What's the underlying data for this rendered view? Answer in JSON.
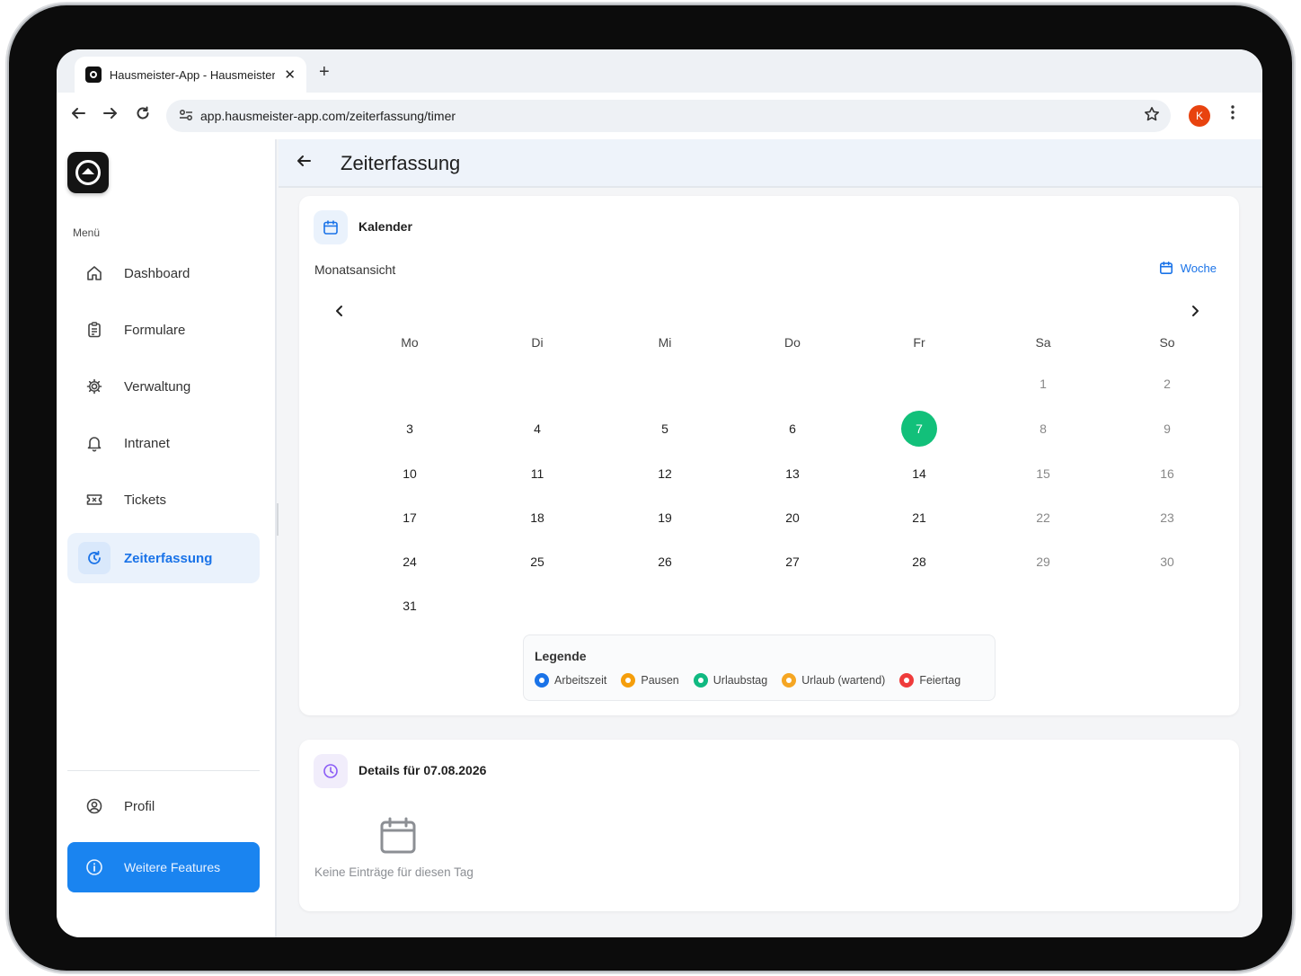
{
  "browser": {
    "tab_title": "Hausmeister-App - Hausmeister",
    "url": "app.hausmeister-app.com/zeiterfassung/timer",
    "profile_initial": "K",
    "new_tab": "+",
    "close": "✕"
  },
  "sidebar": {
    "menu_label": "Menü",
    "items": [
      {
        "label": "Dashboard",
        "icon": "home-icon"
      },
      {
        "label": "Formulare",
        "icon": "clipboard-icon"
      },
      {
        "label": "Verwaltung",
        "icon": "gear-icon"
      },
      {
        "label": "Intranet",
        "icon": "bell-icon"
      },
      {
        "label": "Tickets",
        "icon": "ticket-icon"
      },
      {
        "label": "Zeiterfassung",
        "icon": "timer-icon",
        "active": true
      }
    ],
    "profile_label": "Profil",
    "features_label": "Weitere Features"
  },
  "header": {
    "title": "Zeiterfassung"
  },
  "calendar": {
    "title": "Kalender",
    "view_label": "Monatsansicht",
    "week_button": "Woche",
    "weekdays": [
      "Mo",
      "Di",
      "Mi",
      "Do",
      "Fr",
      "Sa",
      "So"
    ],
    "first_weekday_index": 5,
    "days_in_month": 31,
    "selected_day": 7,
    "legend_title": "Legende",
    "legend": [
      {
        "label": "Arbeitszeit",
        "color": "#1a73e8"
      },
      {
        "label": "Pausen",
        "color": "#f59e0b"
      },
      {
        "label": "Urlaubstag",
        "color": "#10b981"
      },
      {
        "label": "Urlaub (wartend)",
        "color": "#f5a623"
      },
      {
        "label": "Feiertag",
        "color": "#ef3b3b"
      }
    ]
  },
  "details": {
    "title": "Details für 07.08.2026",
    "empty_text": "Keine Einträge für diesen Tag"
  },
  "colors": {
    "accent": "#1a73e8",
    "today": "#12c07a",
    "features_button": "#1a84f0"
  }
}
